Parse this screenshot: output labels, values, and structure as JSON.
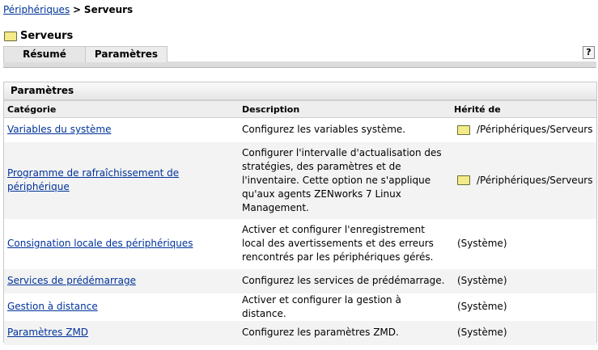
{
  "breadcrumb": {
    "parent": "Périphériques",
    "separator": ">",
    "current": "Serveurs"
  },
  "page_title": "Serveurs",
  "tabs": [
    {
      "label": "Résumé"
    },
    {
      "label": "Paramètres"
    }
  ],
  "help_label": "?",
  "panel": {
    "title": "Paramètres",
    "columns": [
      "Catégorie",
      "Description",
      "Hérité de"
    ],
    "rows": [
      {
        "category": "Variables du système",
        "description": "Configurez les variables système.",
        "inherited": "/Périphériques/Serveurs",
        "folder": true
      },
      {
        "category": "Programme de rafraîchissement de périphérique",
        "description": "Configurer l'intervalle d'actualisation des stratégies, des paramètres et de l'inventaire. Cette option ne s'applique qu'aux agents ZENworks 7 Linux Management.",
        "inherited": "/Périphériques/Serveurs",
        "folder": true
      },
      {
        "category": "Consignation locale des périphériques",
        "description": "Activer et configurer l'enregistrement local des avertissements et des erreurs rencontrés par les périphériques gérés.",
        "inherited": "(Système)",
        "folder": false
      },
      {
        "category": "Services de prédémarrage",
        "description": "Configurez les services de prédémarrage.",
        "inherited": "(Système)",
        "folder": false
      },
      {
        "category": "Gestion à distance",
        "description": "Activer et configurer la gestion à distance.",
        "inherited": "(Système)",
        "folder": false
      },
      {
        "category": "Paramètres ZMD",
        "description": "Configurez les paramètres ZMD.",
        "inherited": "(Système)",
        "folder": false
      }
    ]
  }
}
